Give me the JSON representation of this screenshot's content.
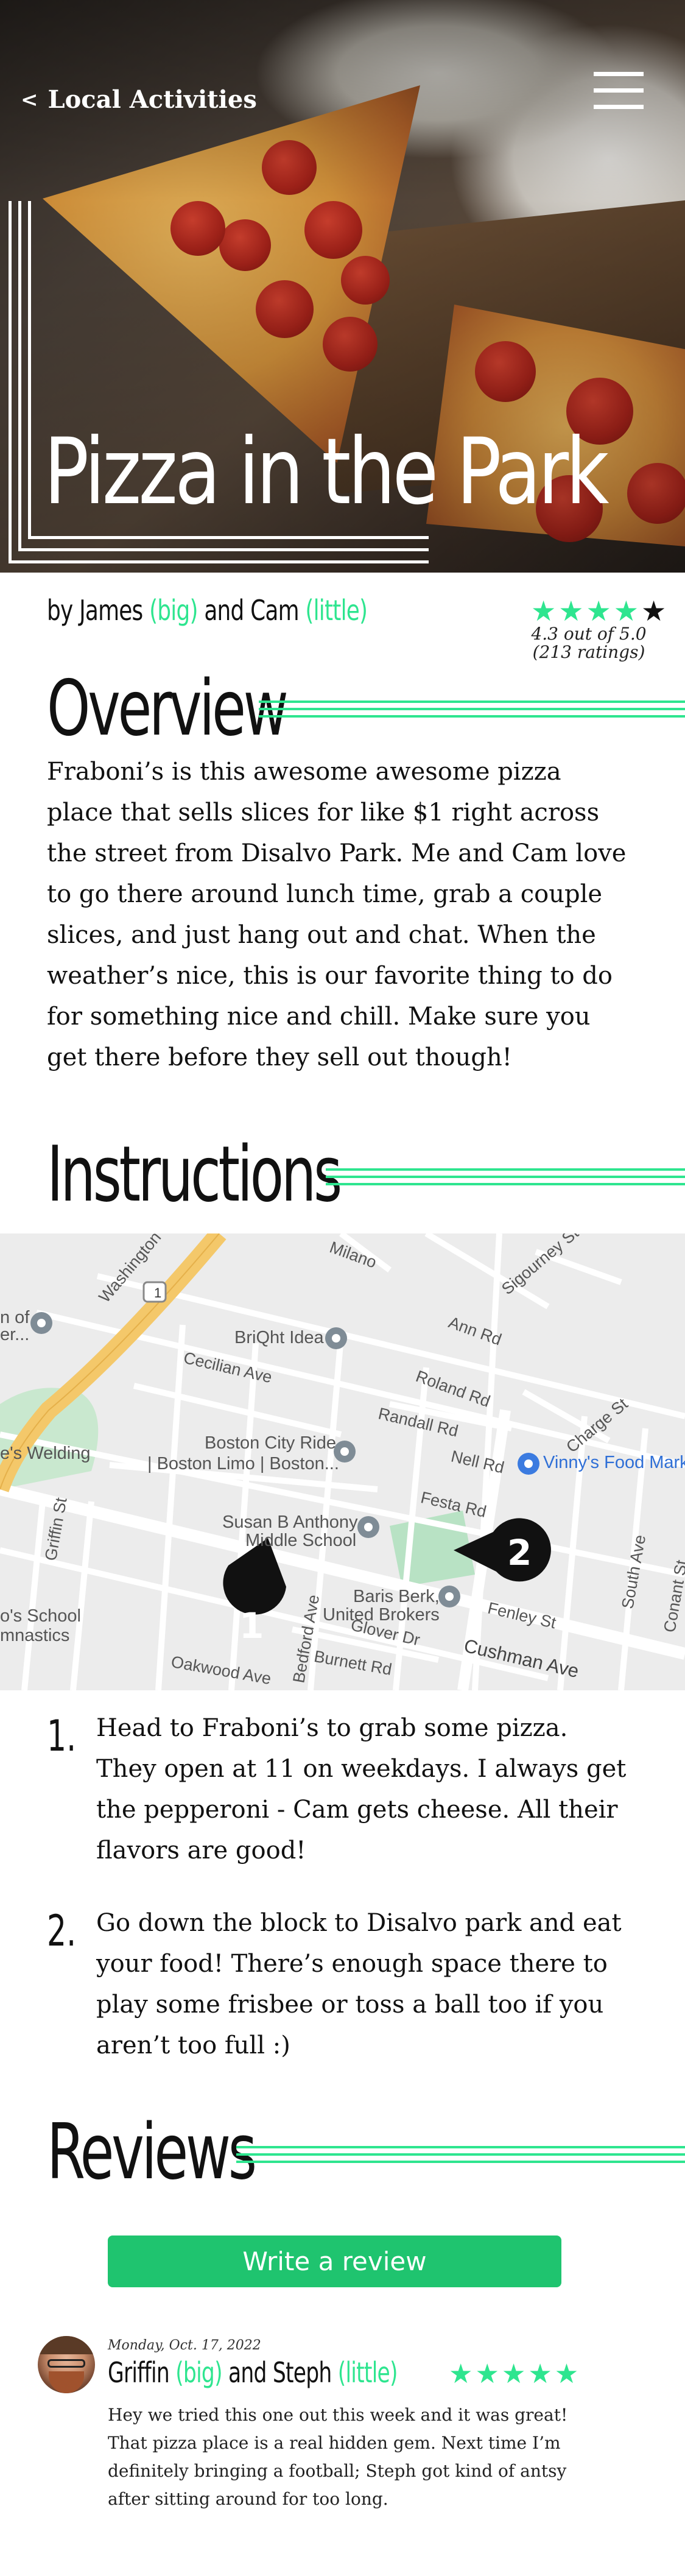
{
  "header": {
    "back_label": "Local Activities",
    "back_icon": "chevron-left-icon",
    "menu_icon": "hamburger-menu-icon",
    "title": "Pizza in the Park"
  },
  "byline": {
    "prefix": "by James ",
    "tag1": "(big)",
    "middle": " and Cam ",
    "tag2": "(little)"
  },
  "rating": {
    "stars": "★★★★",
    "last_star": "★",
    "value": 4.3,
    "summary": "4.3 out of 5.0",
    "count": "(213 ratings)"
  },
  "overview": {
    "heading": "Overview",
    "text": "Fraboni’s is this awesome awesome pizza place that sells slices for like $1 right across the street from Disalvo Park. Me and Cam love to go there around lunch time, grab a couple slices, and just hang out and chat. When the weather’s nice, this is our favorite thing to do for something nice and chill. Make sure you get there before they sell out though!"
  },
  "instructions": {
    "heading": "Instructions",
    "map": {
      "roads": [
        "Washington",
        "Milano",
        "Sigourney St",
        "Ann Rd",
        "Cecilian Ave",
        "Roland Rd",
        "Randall Rd",
        "Charge St",
        "Nell Rd",
        "Festa Rd",
        "Griffin St",
        "Glover Dr",
        "Fenley St",
        "Cushman Ave",
        "Oakwood Ave",
        "Bedford Ave",
        "Burnett Rd",
        "South Ave",
        "Conant St"
      ],
      "pois": {
        "brightidea": "BriQht Idea",
        "citylimo_1": "Boston City Ride",
        "citylimo_2": "| Boston Limo | Boston...",
        "school_1": "Susan B Anthony",
        "school_2": "Middle School",
        "baris_1": "Baris Berk,",
        "baris_2": "United Brokers",
        "vinnys": "Vinny's Food Marke",
        "welding": "e's Welding",
        "gym_1": "o's School",
        "gym_2": "mnastics",
        "left_1": "n of",
        "left_2": "er..."
      },
      "route_shield": "1",
      "markers": [
        "1",
        "2"
      ]
    },
    "steps": [
      {
        "num": "1.",
        "text": "Head to Fraboni’s to grab some pizza. They open at 11 on weekdays. I always get the pepperoni - Cam gets cheese. All their flavors are good!"
      },
      {
        "num": "2.",
        "text": "Go down the block to Disalvo park and eat your food! There’s enough space there to play some frisbee or toss a ball too if you aren’t too full :)"
      }
    ]
  },
  "reviews": {
    "heading": "Reviews",
    "write_label": "Write a review",
    "items": [
      {
        "date": "Monday, Oct. 17, 2022",
        "author_prefix": "Griffin ",
        "tag1": "(big)",
        "author_middle": " and Steph ",
        "tag2": "(little)",
        "stars": "★★★★★",
        "rating": 5,
        "text": "Hey we tried this one out this week and it was great! That pizza place is a real hidden gem. Next time I’m definitely bringing a football; Steph got kind of antsy after sitting around for too long."
      }
    ]
  },
  "colors": {
    "accent": "#2ee58f",
    "button": "#1fc46f",
    "text": "#111111"
  }
}
